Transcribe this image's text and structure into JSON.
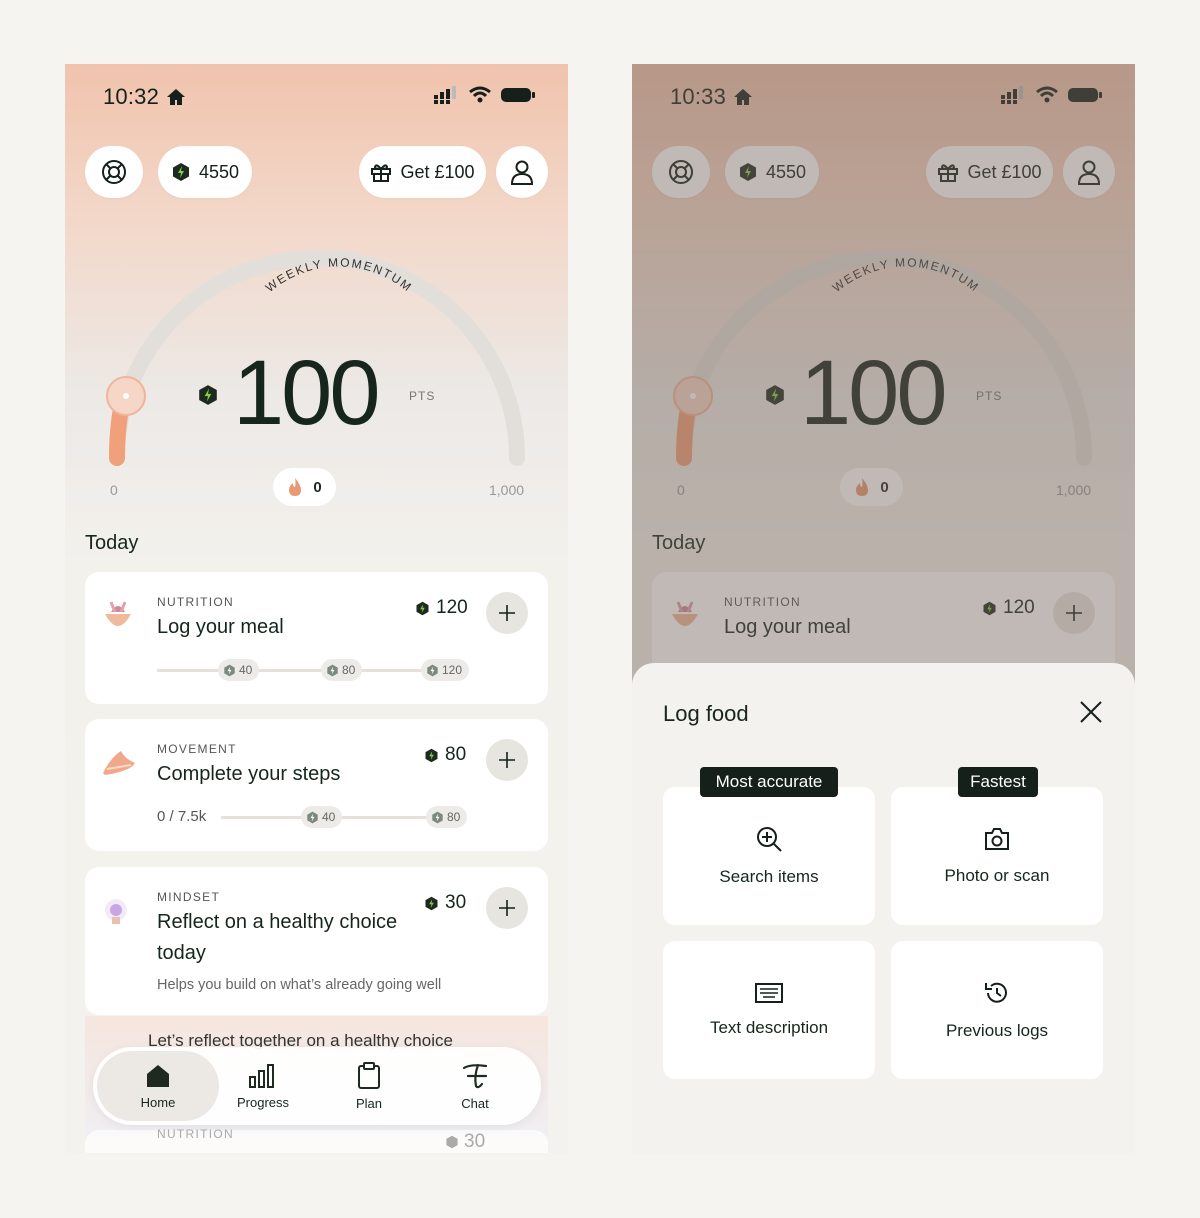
{
  "colors": {
    "accent": "#f0a07a",
    "brand_dark": "#16261c",
    "points_green": "#2f6a2a"
  },
  "left_screen": {
    "status": {
      "time": "10:32"
    },
    "header": {
      "points": "4550",
      "referral": "Get £100"
    },
    "momentum": {
      "label": "WEEKLY MOMENTUM",
      "value": "100",
      "unit": "PTS",
      "min": "0",
      "max": "1,000",
      "progress_fraction": 0.0,
      "streak": "0"
    },
    "today_title": "Today",
    "tasks": [
      {
        "category": "NUTRITION",
        "title": "Log your meal",
        "points": "120",
        "milestones": [
          "40",
          "80",
          "120"
        ]
      },
      {
        "category": "MOVEMENT",
        "title": "Complete your steps",
        "points": "80",
        "progress": "0 / 7.5k",
        "milestones": [
          "40",
          "80"
        ]
      },
      {
        "category": "MINDSET",
        "title_line1": "Reflect on a healthy choice",
        "title_line2": "today",
        "points": "30",
        "subtitle": "Helps you build on what’s already going well"
      }
    ],
    "behind_nav": {
      "reflect_text": "Let’s reflect together on a healthy choice",
      "category": "NUTRITION",
      "points": "30"
    },
    "nav": [
      {
        "label": "Home",
        "icon": "home-icon"
      },
      {
        "label": "Progress",
        "icon": "bar-chart-icon"
      },
      {
        "label": "Plan",
        "icon": "clipboard-icon"
      },
      {
        "label": "Chat",
        "icon": "chat-icon"
      }
    ]
  },
  "right_screen": {
    "status": {
      "time": "10:33"
    },
    "header": {
      "points": "4550",
      "referral": "Get £100"
    },
    "momentum": {
      "label": "WEEKLY MOMENTUM",
      "value": "100",
      "unit": "PTS",
      "min": "0",
      "max": "1,000",
      "streak": "0"
    },
    "today_title": "Today",
    "task": {
      "category": "NUTRITION",
      "title": "Log your meal",
      "points": "120"
    },
    "sheet": {
      "title": "Log food",
      "options": [
        {
          "label": "Search items",
          "tag": "Most accurate",
          "icon": "search-plus-icon"
        },
        {
          "label": "Photo or scan",
          "tag": "Fastest",
          "icon": "camera-icon"
        },
        {
          "label": "Text description",
          "icon": "keyboard-icon"
        },
        {
          "label": "Previous logs",
          "icon": "history-icon"
        }
      ]
    }
  }
}
